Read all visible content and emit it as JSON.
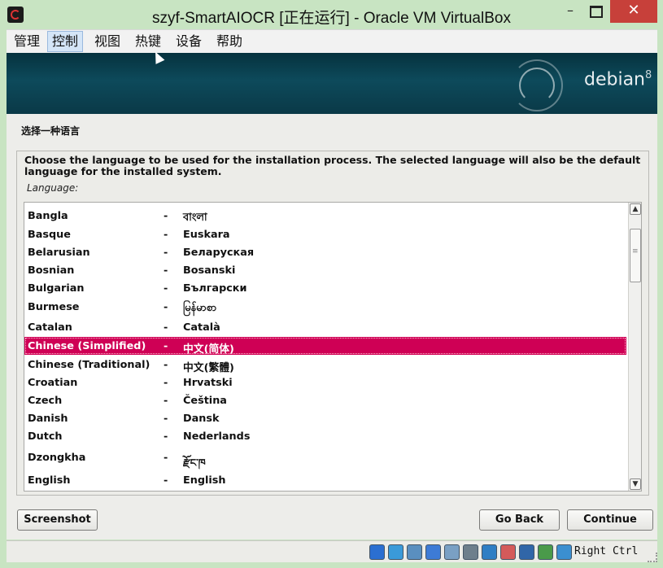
{
  "window": {
    "title": "szyf-SmartAIOCR [正在运行] - Oracle VM VirtualBox",
    "minimize": "–",
    "close": "✕"
  },
  "menu": [
    "管理",
    "控制",
    "视图",
    "热键",
    "设备",
    "帮助"
  ],
  "brand": {
    "name": "debian",
    "version": "8"
  },
  "page": {
    "heading": "选择一种语言",
    "description": "Choose the language to be used for the installation process. The selected language will also be the default language for the installed system.",
    "list_label": "Language:"
  },
  "languages": [
    {
      "name": "Bangla",
      "sep": "-",
      "native": "বাংলা"
    },
    {
      "name": "Basque",
      "sep": "-",
      "native": "Euskara"
    },
    {
      "name": "Belarusian",
      "sep": "-",
      "native": "Беларуская"
    },
    {
      "name": "Bosnian",
      "sep": "-",
      "native": "Bosanski"
    },
    {
      "name": "Bulgarian",
      "sep": "-",
      "native": "Български"
    },
    {
      "name": "Burmese",
      "sep": "-",
      "native": "မြန်မာစာ"
    },
    {
      "name": "Catalan",
      "sep": "-",
      "native": "Català"
    },
    {
      "name": "Chinese (Simplified)",
      "sep": "-",
      "native": "中文(简体)"
    },
    {
      "name": "Chinese (Traditional)",
      "sep": "-",
      "native": "中文(繁體)"
    },
    {
      "name": "Croatian",
      "sep": "-",
      "native": "Hrvatski"
    },
    {
      "name": "Czech",
      "sep": "-",
      "native": "Čeština"
    },
    {
      "name": "Danish",
      "sep": "-",
      "native": "Dansk"
    },
    {
      "name": "Dutch",
      "sep": "-",
      "native": "Nederlands"
    },
    {
      "name": "Dzongkha",
      "sep": "-",
      "native": "རྫོང་ཁ"
    },
    {
      "name": "English",
      "sep": "-",
      "native": "English"
    }
  ],
  "selected_language": "Chinese (Simplified)",
  "buttons": {
    "screenshot": "Screenshot",
    "go_back": "Go Back",
    "continue": "Continue"
  },
  "statusbar": {
    "host_key": "Right Ctrl",
    "icons": [
      "hard-disk-icon",
      "optical-drive-icon",
      "audio-icon",
      "network-icon",
      "usb-icon",
      "shared-folders-icon",
      "display-icon",
      "recording-icon",
      "virtualization-icon",
      "mouse-integration-icon",
      "keyboard-capture-icon"
    ]
  },
  "colors": {
    "selection": "#cf0055",
    "banner": "#0d4a5b",
    "chrome": "#c8e4c2"
  }
}
